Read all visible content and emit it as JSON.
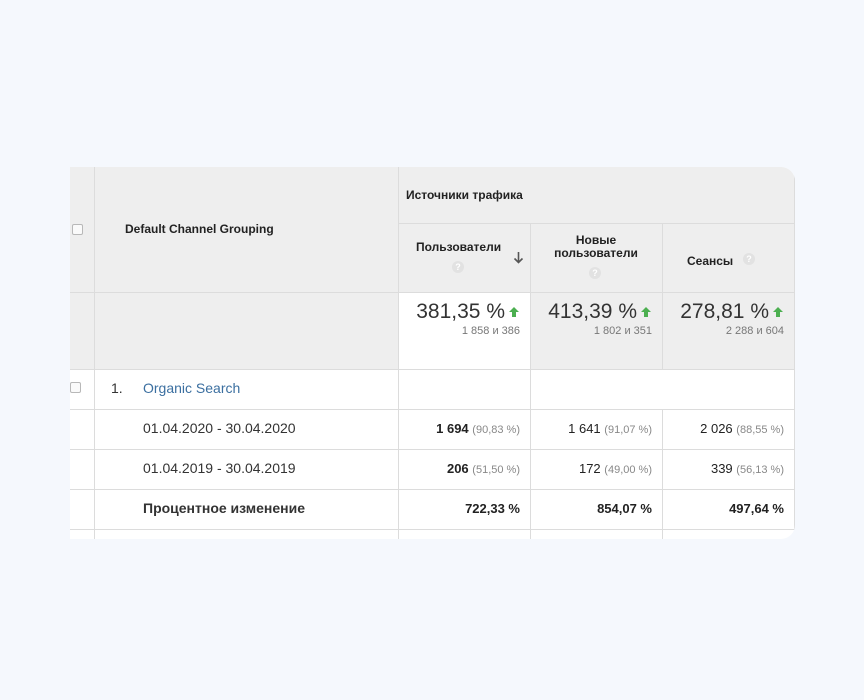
{
  "header": {
    "dimension_label": "Default Channel Grouping",
    "group_label": "Источники трафика",
    "columns": [
      {
        "label": "Пользователи",
        "help": "?"
      },
      {
        "label": "Новые пользователи",
        "help": "?"
      },
      {
        "label": "Сеансы",
        "help": "?"
      }
    ]
  },
  "summary": [
    {
      "value": "381,35 %",
      "detail": "1 858 и 386"
    },
    {
      "value": "413,39 %",
      "detail": "1 802 и 351"
    },
    {
      "value": "278,81 %",
      "detail": "2 288 и 604"
    }
  ],
  "group_row": {
    "index": "1.",
    "name": "Organic Search"
  },
  "rows": [
    {
      "label": "01.04.2020 - 30.04.2020",
      "cells": [
        {
          "value": "1 694",
          "pct": "(90,83 %)"
        },
        {
          "value": "1 641",
          "pct": "(91,07 %)"
        },
        {
          "value": "2 026",
          "pct": "(88,55 %)"
        }
      ]
    },
    {
      "label": "01.04.2019 - 30.04.2019",
      "cells": [
        {
          "value": "206",
          "pct": "(51,50 %)"
        },
        {
          "value": "172",
          "pct": "(49,00 %)"
        },
        {
          "value": "339",
          "pct": "(56,13 %)"
        }
      ]
    }
  ],
  "change_row": {
    "label": "Процентное изменение",
    "values": [
      "722,33 %",
      "854,07 %",
      "497,64 %"
    ]
  },
  "colors": {
    "up_arrow": "#4caf50",
    "link": "#3b6fa0",
    "header_bg": "#eeeeee"
  }
}
